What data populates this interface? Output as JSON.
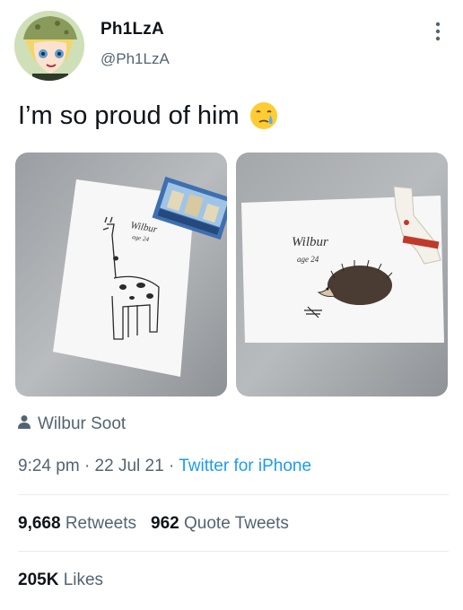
{
  "author": {
    "display_name": "Ph1LzA",
    "handle": "@Ph1LzA"
  },
  "tweet": {
    "text": "I’m so proud of him",
    "emoji": "crying-face-icon"
  },
  "media": {
    "left_drawing": {
      "signature": "Wilbur",
      "age": "age 24",
      "subject": "giraffe"
    },
    "right_drawing": {
      "signature": "Wilbur",
      "age": "age 24",
      "subject": "hedgehog"
    }
  },
  "tagged_user": "Wilbur Soot",
  "meta": {
    "time": "9:24 pm",
    "date": "22 Jul 21",
    "source": "Twitter for iPhone"
  },
  "stats": {
    "retweets_count": "9,668",
    "retweets_label": "Retweets",
    "quotes_count": "962",
    "quotes_label": "Quote Tweets",
    "likes_count": "205K",
    "likes_label": "Likes"
  },
  "colors": {
    "link": "#1d9bf0",
    "secondary_text": "#536471",
    "primary_text": "#0f1419"
  }
}
